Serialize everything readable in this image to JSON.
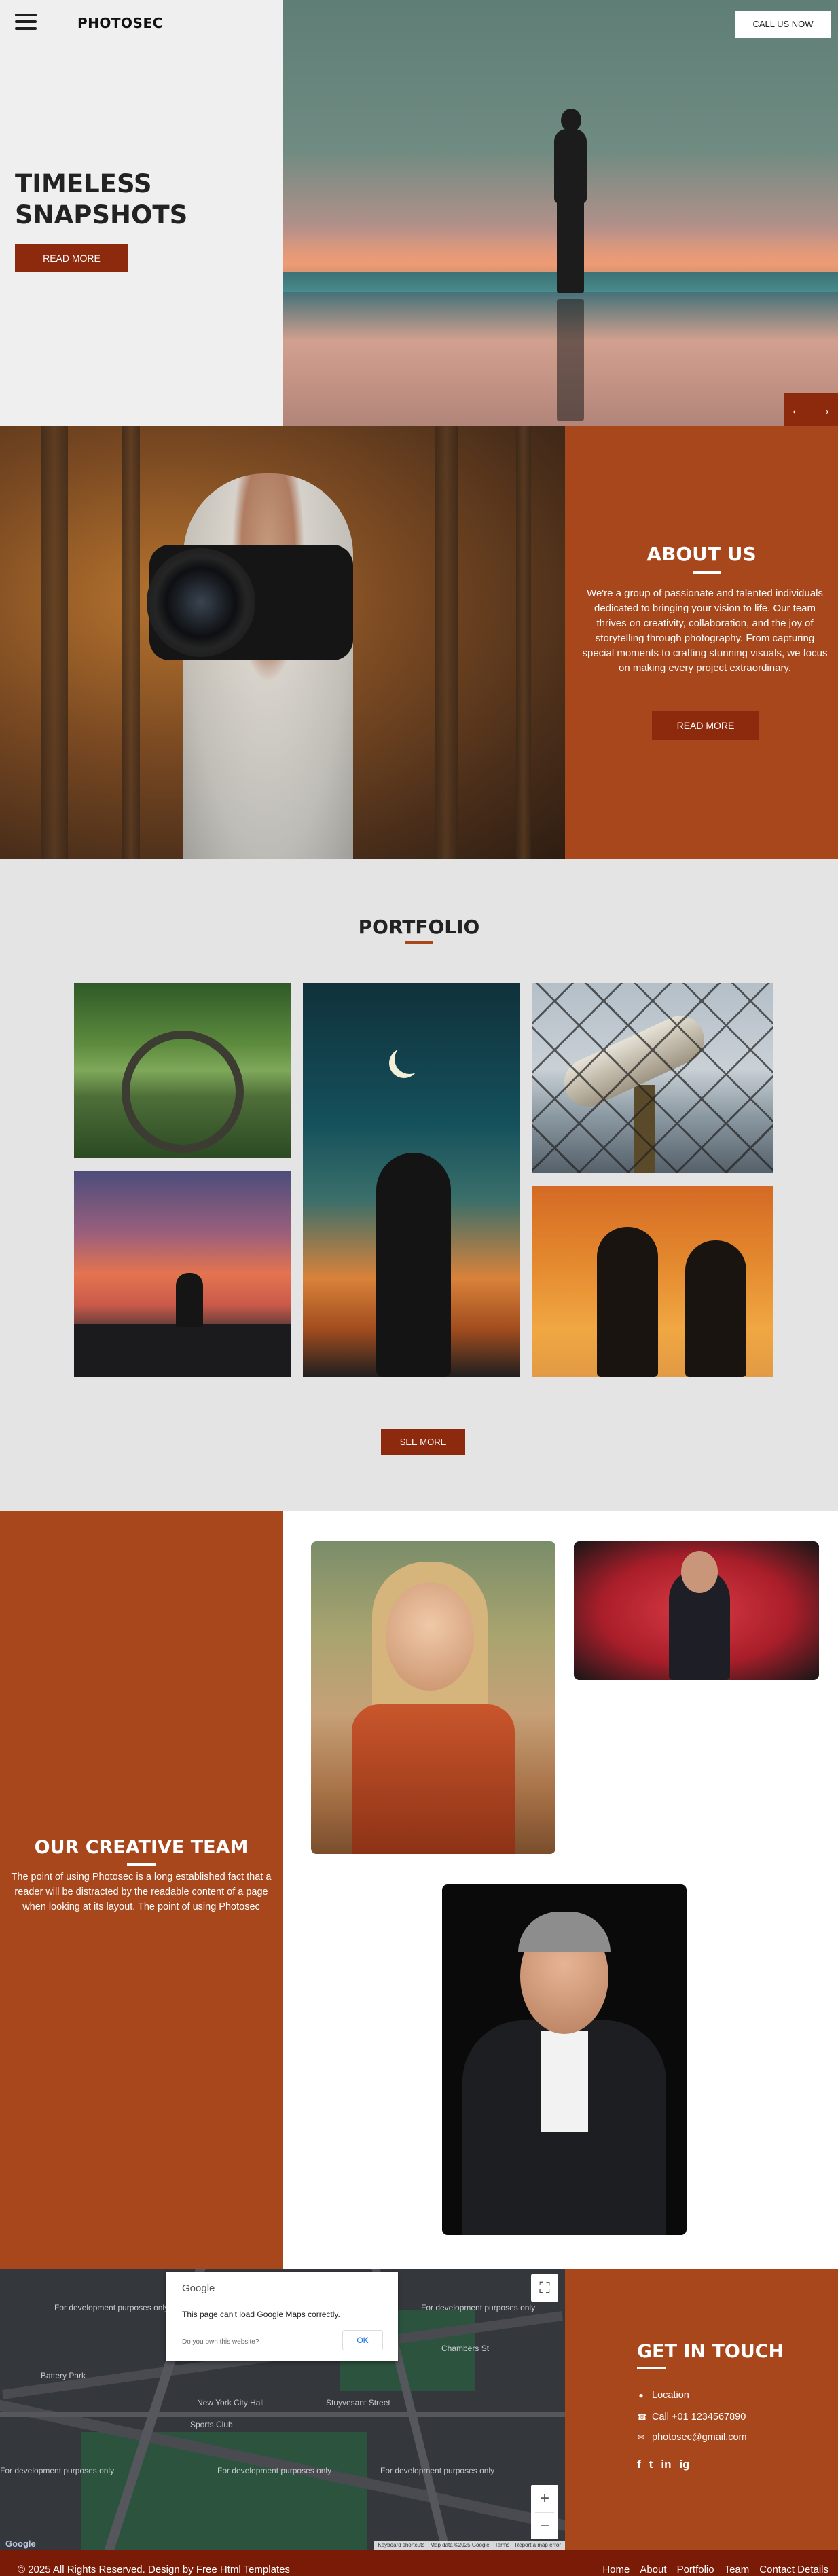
{
  "header": {
    "brand": "PHOTOSEC",
    "call_button": "CALL US NOW"
  },
  "hero": {
    "title_line1": "TIMELESS",
    "title_line2": "SNAPSHOTS",
    "read_more": "READ MORE",
    "prev_arrow": "←",
    "next_arrow": "→"
  },
  "about": {
    "title": "ABOUT US",
    "text": "We're a group of passionate and talented individuals dedicated to bringing your vision to life. Our team thrives on creativity, collaboration, and the joy of storytelling through photography. From capturing special moments to crafting stunning visuals, we focus on making every project extraordinary.",
    "read_more": "READ MORE"
  },
  "portfolio": {
    "title": "PORTFOLIO",
    "see_more": "SEE MORE"
  },
  "team": {
    "title": "OUR CREATIVE TEAM",
    "text": "The point of using Photosec is a long established fact that a reader will be distracted by the readable content of a page when looking at its layout. The point of using Photosec"
  },
  "map": {
    "dialog_brand": "Google",
    "dialog_message": "This page can't load Google Maps correctly.",
    "dialog_own": "Do you own this website?",
    "dialog_ok": "OK",
    "watermark": "For development purposes only",
    "labels": [
      "New York City Hall",
      "Battery Park",
      "Stuyvesant Street",
      "Chambers St",
      "Sports Club"
    ],
    "footer_links": [
      "Keyboard shortcuts",
      "Map data ©2025 Google",
      "Terms",
      "Report a map error"
    ],
    "zoom_in": "+",
    "zoom_out": "−",
    "fullscreen": "⛶",
    "google_logo": "Google"
  },
  "contact": {
    "title": "GET IN TOUCH",
    "location": "Location",
    "phone": "Call +01 1234567890",
    "email": "photosec@gmail.com",
    "social": [
      "f",
      "t",
      "in",
      "ig"
    ]
  },
  "footer": {
    "copyright": "© 2025 All Rights Reserved. Design by Free Html Templates",
    "nav": [
      "Home",
      "About",
      "Portfolio",
      "Team",
      "Contact Details"
    ]
  },
  "colors": {
    "brand_brown": "#a8461c",
    "button_dark": "#8d2a0d",
    "footer_bg": "#7a1b07"
  }
}
